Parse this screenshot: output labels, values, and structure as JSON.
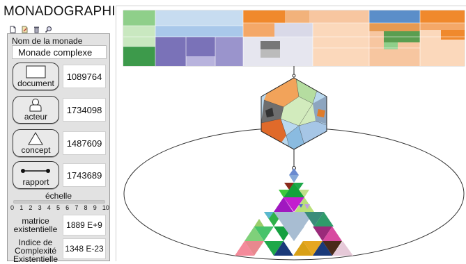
{
  "app": {
    "title": "MONADOGRAPHIE"
  },
  "toolbar": {
    "icons": [
      "new-document-icon",
      "edit-icon",
      "delete-icon",
      "search-icon"
    ]
  },
  "monade": {
    "name_label": "Nom de la monade",
    "name_value": "Monade complexe"
  },
  "entities": [
    {
      "label": "document",
      "value": "1089764",
      "icon": "rectangle-icon"
    },
    {
      "label": "acteur",
      "value": "1734098",
      "icon": "actor-icon"
    },
    {
      "label": "concept",
      "value": "1487609",
      "icon": "triangle-icon"
    },
    {
      "label": "rapport",
      "value": "1743689",
      "icon": "link-icon"
    }
  ],
  "scale": {
    "label": "échelle",
    "ticks": [
      "0",
      "1",
      "2",
      "3",
      "4",
      "5",
      "6",
      "7",
      "8",
      "9",
      "10"
    ]
  },
  "stats": [
    {
      "label": "matrice existentielle",
      "value": "1889 E+9"
    },
    {
      "label": "Indice de Complexité Existentielle",
      "value": "1348 E-23"
    }
  ],
  "colors": {
    "panel_bg": "#e2e2e2",
    "treemap_green": "#4aa35a",
    "treemap_purple": "#7a72b8",
    "treemap_orange": "#f0892c",
    "treemap_blue": "#5b8ec9",
    "treemap_peach": "#f7c6a0"
  }
}
